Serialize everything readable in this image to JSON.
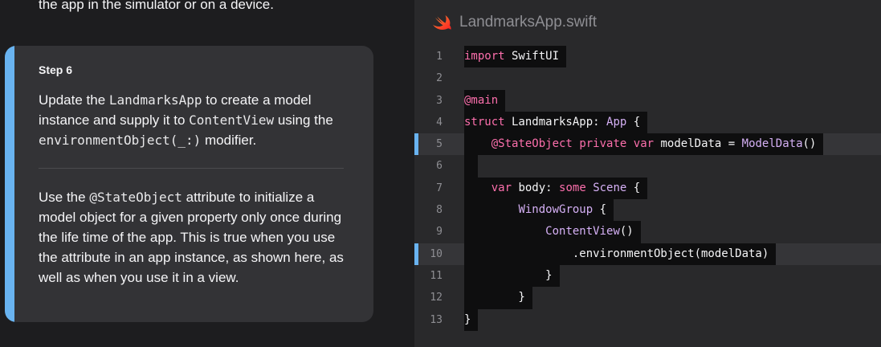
{
  "intro": {
    "text_fragment": "the app in the simulator or on a device."
  },
  "step": {
    "label": "Step 6",
    "para1": [
      "Update the ",
      "LandmarksApp",
      " to create a model instance and supply it to ",
      "ContentView",
      " using the ",
      "environmentObject(_:)",
      " modifier."
    ],
    "para2": [
      "Use the ",
      "@StateObject",
      " attribute to initialize a model object for a given property only once during the life time of the app. This is true when you use the attribute in an app instance, as shown here, as well as when you use it in a view."
    ]
  },
  "code": {
    "file_name": "LandmarksApp.swift",
    "file_icon": "swift-logo-icon",
    "accent_color": "#69b3f0",
    "lines": [
      {
        "num": "1",
        "tokens": [
          {
            "t": "import",
            "k": "kw"
          },
          {
            "t": " SwiftUI",
            "k": "plain"
          }
        ]
      },
      {
        "num": "2",
        "tokens": []
      },
      {
        "num": "3",
        "tokens": [
          {
            "t": "@main",
            "k": "attr"
          }
        ]
      },
      {
        "num": "4",
        "tokens": [
          {
            "t": "struct",
            "k": "kw"
          },
          {
            "t": " LandmarksApp: ",
            "k": "plain"
          },
          {
            "t": "App",
            "k": "type"
          },
          {
            "t": " {",
            "k": "plain"
          }
        ]
      },
      {
        "num": "5",
        "highlight": true,
        "tokens": [
          {
            "t": "    ",
            "k": "plain"
          },
          {
            "t": "@StateObject",
            "k": "attr"
          },
          {
            "t": " ",
            "k": "plain"
          },
          {
            "t": "private",
            "k": "kw"
          },
          {
            "t": " ",
            "k": "plain"
          },
          {
            "t": "var",
            "k": "kw"
          },
          {
            "t": " modelData = ",
            "k": "plain"
          },
          {
            "t": "ModelData",
            "k": "type"
          },
          {
            "t": "()",
            "k": "plain"
          }
        ]
      },
      {
        "num": "6",
        "tokens": [
          {
            "t": " ",
            "k": "plain"
          }
        ]
      },
      {
        "num": "7",
        "tokens": [
          {
            "t": "    ",
            "k": "plain"
          },
          {
            "t": "var",
            "k": "kw"
          },
          {
            "t": " body: ",
            "k": "plain"
          },
          {
            "t": "some",
            "k": "kw"
          },
          {
            "t": " ",
            "k": "plain"
          },
          {
            "t": "Scene",
            "k": "type"
          },
          {
            "t": " {",
            "k": "plain"
          }
        ]
      },
      {
        "num": "8",
        "tokens": [
          {
            "t": "        ",
            "k": "plain"
          },
          {
            "t": "WindowGroup",
            "k": "type"
          },
          {
            "t": " {",
            "k": "plain"
          }
        ]
      },
      {
        "num": "9",
        "tokens": [
          {
            "t": "            ",
            "k": "plain"
          },
          {
            "t": "ContentView",
            "k": "type"
          },
          {
            "t": "()",
            "k": "plain"
          }
        ]
      },
      {
        "num": "10",
        "highlight": true,
        "tokens": [
          {
            "t": "                .environmentObject(modelData)",
            "k": "plain"
          }
        ]
      },
      {
        "num": "11",
        "tokens": [
          {
            "t": "            }",
            "k": "plain"
          }
        ]
      },
      {
        "num": "12",
        "tokens": [
          {
            "t": "        }",
            "k": "plain"
          }
        ]
      },
      {
        "num": "13",
        "tokens": [
          {
            "t": "}",
            "k": "plain"
          }
        ]
      }
    ]
  }
}
